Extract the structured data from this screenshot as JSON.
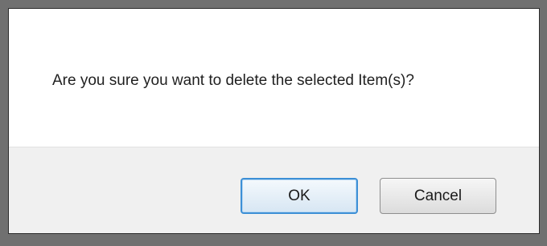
{
  "dialog": {
    "message": "Are you sure you want to delete the selected Item(s)?",
    "ok_label": "OK",
    "cancel_label": "Cancel"
  },
  "colors": {
    "focus_border": "#3c8fd6",
    "footer_bg": "#f0f0f0",
    "body_bg": "#ffffff"
  }
}
